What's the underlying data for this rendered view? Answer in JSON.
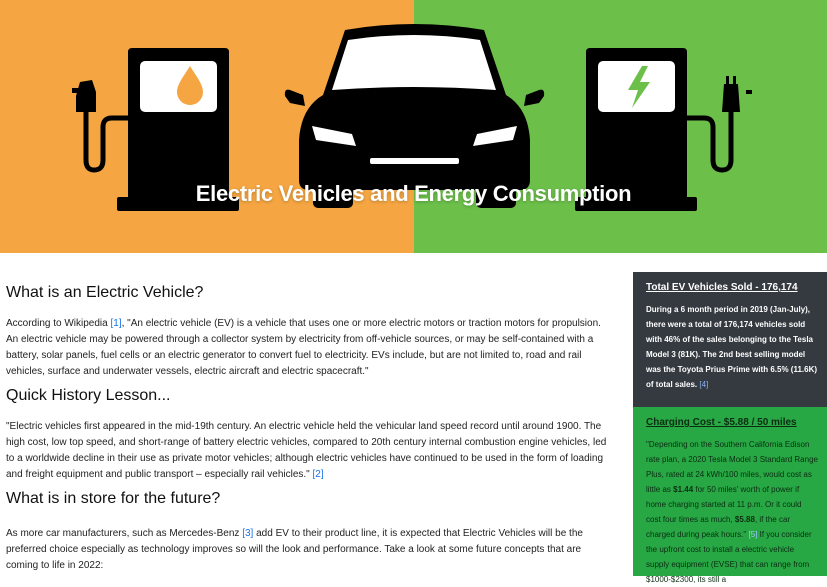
{
  "hero": {
    "title": "Electric Vehicles and Energy Consumption",
    "left_color": "#f5a642",
    "right_color": "#6cc04a",
    "icons": [
      "gas-pump-icon",
      "car-icon",
      "charging-station-icon"
    ]
  },
  "sections": {
    "what": {
      "heading": "What is an Electric Vehicle?",
      "text_before": "According to Wikipedia ",
      "ref": "[1]",
      "text_after": ", \"An electric vehicle (EV) is a vehicle that uses one or more electric motors or traction motors for propulsion. An electric vehicle may be powered through a collector system by electricity from off-vehicle sources, or may be self-contained with a battery, solar panels, fuel cells or an electric generator to convert fuel to electricity. EVs include, but are not limited to, road and rail vehicles, surface and underwater vessels, electric aircraft and electric spacecraft.\""
    },
    "history": {
      "heading": "Quick History Lesson...",
      "text": "\"Electric vehicles first appeared in the mid-19th century. An electric vehicle held the vehicular land speed record until around 1900. The high cost, low top speed, and short-range of battery electric vehicles, compared to 20th century internal combustion engine vehicles, led to a worldwide decline in their use as private motor vehicles; although electric vehicles have continued to be used in the form of loading and freight equipment and public transport – especially rail vehicles.\" ",
      "ref": "[2]"
    },
    "future": {
      "heading": "What is in store for the future?",
      "text_before": "As more car manufacturers, such as Mercedes-Benz ",
      "ref": "[3]",
      "text_after": " add EV to their product line, it is expected that Electric Vehicles will be the preferred choice especially as technology improves so will the look and performance. Take a look at some future concepts that are coming to life in 2022:"
    }
  },
  "sidebar": {
    "sold": {
      "title": "Total EV Vehicles Sold - 176,174",
      "body": "During a 6 month period in 2019 (Jan-July), there were a total of 176,174 vehicles sold with 46% of the sales belonging to the Tesla Model 3 (81K). The 2nd best selling model was the Toyota Prius Prime with 6.5% (11.6K) of total sales. ",
      "ref": "[4]",
      "color": "#343a40"
    },
    "cost": {
      "title": "Charging Cost - $5.88 / 50 miles",
      "body_1": "\"Depending on the Southern California Edison rate plan, a 2020 Tesla Model 3 Standard Range Plus, rated at 24 kWh/100 miles, would cost as little as ",
      "bold_1": "$1.44",
      "body_2": " for 50 miles' worth of power if home charging started at 11 p.m. Or it could cost four times as much, ",
      "bold_2": "$5.88",
      "body_3": ", if the car charged during peak hours.\" ",
      "ref": "[5]",
      "body_4": " If you consider the upfront cost to install a electric vehicle supply equipment (EVSE) that can range from $1000-$2300, its still a",
      "color": "#28a745"
    }
  }
}
